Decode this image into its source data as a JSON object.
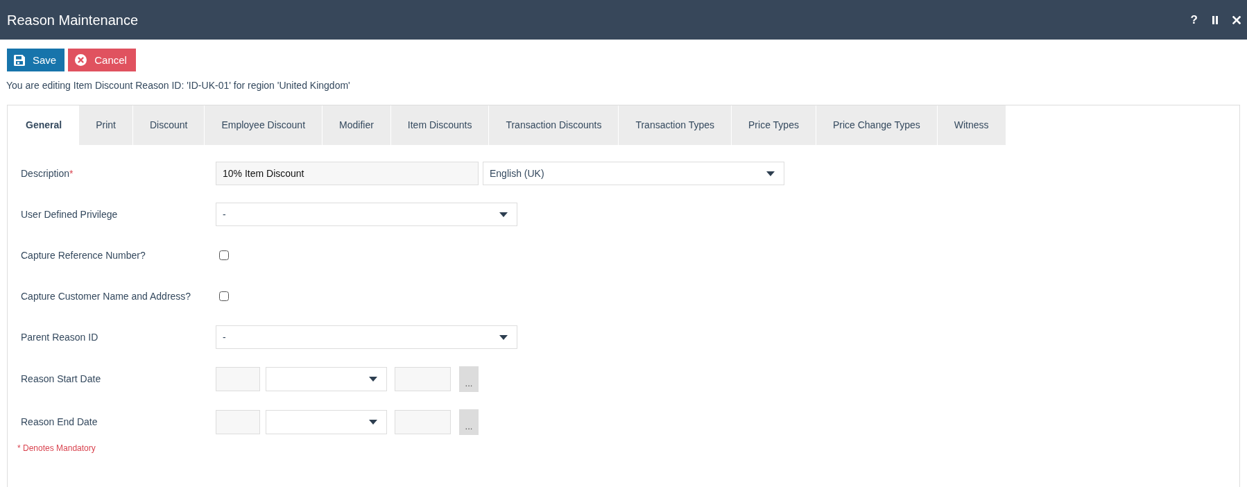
{
  "window": {
    "title": "Reason Maintenance",
    "controls": [
      {
        "kind": "help",
        "label": "?"
      },
      {
        "kind": "pause"
      },
      {
        "kind": "close"
      }
    ]
  },
  "toolbar": [
    {
      "kind": "save",
      "label": "Save"
    },
    {
      "kind": "cancel",
      "label": "Cancel"
    }
  ],
  "edit_notice": "You are editing Item Discount Reason ID: 'ID-UK-01' for region 'United Kingdom'",
  "tabs": [
    {
      "label": "General",
      "selected": true
    },
    {
      "label": "Print",
      "selected": false
    },
    {
      "label": "Discount",
      "selected": false
    },
    {
      "label": "Employee Discount",
      "selected": false
    },
    {
      "label": "Modifier",
      "selected": false
    },
    {
      "label": "Item Discounts",
      "selected": false
    },
    {
      "label": "Transaction Discounts",
      "selected": false
    },
    {
      "label": "Transaction Types",
      "selected": false
    },
    {
      "label": "Price Types",
      "selected": false
    },
    {
      "label": "Price Change Types",
      "selected": false
    },
    {
      "label": "Witness",
      "selected": false
    }
  ],
  "form": {
    "fields": [
      {
        "kind": "text_with_language",
        "label": "Description",
        "required_mark": "*",
        "value": "10% Item Discount",
        "language": "English (UK)"
      },
      {
        "kind": "select",
        "label": "User Defined Privilege",
        "value": "-"
      },
      {
        "kind": "checkbox",
        "label": "Capture Reference Number?",
        "checked": false
      },
      {
        "kind": "checkbox",
        "label": "Capture Customer Name and Address?",
        "checked": false
      },
      {
        "kind": "select",
        "label": "Parent Reason ID",
        "value": "-"
      },
      {
        "kind": "date",
        "label": "Reason Start Date",
        "picker_label": "..."
      },
      {
        "kind": "date",
        "label": "Reason End Date",
        "picker_label": "..."
      }
    ],
    "mandatory_note": "* Denotes Mandatory"
  }
}
